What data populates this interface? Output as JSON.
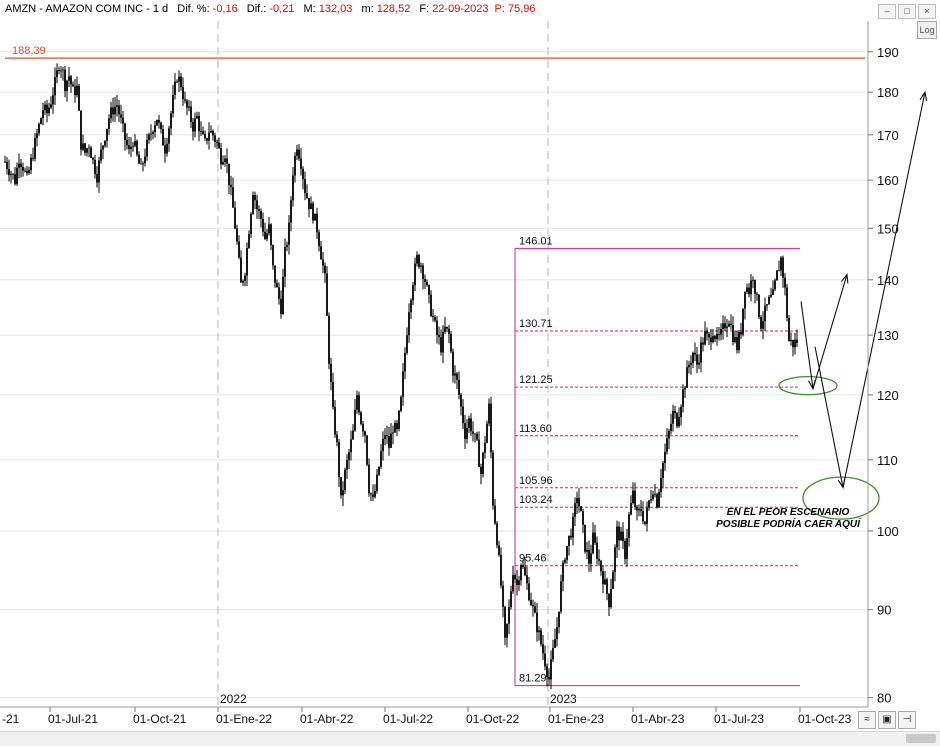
{
  "header": {
    "title": "AMZN - AMAZON COM INC -  1 d",
    "fields": [
      {
        "label": "Dif. %:",
        "value": "-0,16"
      },
      {
        "label": "Dif.:",
        "value": "-0,21"
      },
      {
        "label": "M:",
        "value": "132,03"
      },
      {
        "label": "m:",
        "value": "128,52"
      },
      {
        "label": "F:",
        "value": "22-09-2023"
      }
    ],
    "extra": "P: 75,96",
    "window_buttons": [
      "–",
      "□",
      "×"
    ]
  },
  "controls": {
    "log_label": "Log",
    "toolbar_icons": [
      "wave-icon",
      "save-icon",
      "pin-icon"
    ]
  },
  "colors": {
    "price": "#000000",
    "resistance_line": "#e0502a",
    "fibonacci": "#d0208a",
    "ellipse": "#3f8f2a",
    "arrow": "#111111",
    "header_values": "#d01010"
  },
  "chart_data": {
    "type": "candlestick",
    "symbol": "AMZN",
    "timeframe": "1 d",
    "scale": "log",
    "ylim": [
      79,
      198
    ],
    "y_ticks": [
      80,
      90,
      100,
      110,
      120,
      130,
      140,
      150,
      160,
      170,
      180,
      190
    ],
    "x_ticks": [
      "-21",
      "01-Jul-21",
      "01-Oct-21",
      "01-Ene-22",
      "01-Abr-22",
      "01-Jul-22",
      "01-Oct-22",
      "01-Ene-23",
      "01-Abr-23",
      "01-Jul-23",
      "01-Oct-23"
    ],
    "year_markers": [
      {
        "label": "2022",
        "at": "01-Ene-22"
      },
      {
        "label": "2023",
        "at": "01-Ene-23"
      }
    ],
    "resistance": {
      "value": 188.39,
      "label": "188,39"
    },
    "price_path": [
      [
        0,
        164
      ],
      [
        5,
        162
      ],
      [
        10,
        160
      ],
      [
        14,
        165
      ],
      [
        18,
        163
      ],
      [
        22,
        160
      ],
      [
        26,
        164
      ],
      [
        30,
        168
      ],
      [
        34,
        172
      ],
      [
        38,
        176
      ],
      [
        42,
        175
      ],
      [
        46,
        178
      ],
      [
        50,
        182
      ],
      [
        54,
        187
      ],
      [
        57,
        186
      ],
      [
        60,
        182
      ],
      [
        64,
        184
      ],
      [
        68,
        180
      ],
      [
        72,
        181
      ],
      [
        76,
        168
      ],
      [
        80,
        166
      ],
      [
        84,
        168
      ],
      [
        88,
        164
      ],
      [
        92,
        161
      ],
      [
        96,
        166
      ],
      [
        100,
        170
      ],
      [
        104,
        174
      ],
      [
        108,
        176
      ],
      [
        112,
        177
      ],
      [
        116,
        173
      ],
      [
        120,
        169
      ],
      [
        124,
        166
      ],
      [
        128,
        169
      ],
      [
        132,
        165
      ],
      [
        136,
        162
      ],
      [
        140,
        166
      ],
      [
        144,
        169
      ],
      [
        148,
        172
      ],
      [
        152,
        174
      ],
      [
        156,
        170
      ],
      [
        160,
        167
      ],
      [
        164,
        172
      ],
      [
        168,
        178
      ],
      [
        172,
        184
      ],
      [
        176,
        182
      ],
      [
        180,
        177
      ],
      [
        184,
        175
      ],
      [
        188,
        172
      ],
      [
        192,
        174
      ],
      [
        196,
        170
      ],
      [
        200,
        168
      ],
      [
        204,
        171
      ],
      [
        208,
        170
      ],
      [
        212,
        168
      ],
      [
        216,
        165
      ],
      [
        220,
        166
      ],
      [
        224,
        160
      ],
      [
        228,
        154
      ],
      [
        232,
        147
      ],
      [
        236,
        139
      ],
      [
        240,
        142
      ],
      [
        244,
        150
      ],
      [
        248,
        158
      ],
      [
        252,
        154
      ],
      [
        256,
        152
      ],
      [
        260,
        148
      ],
      [
        264,
        150
      ],
      [
        268,
        142
      ],
      [
        272,
        138
      ],
      [
        276,
        135
      ],
      [
        280,
        145
      ],
      [
        284,
        150
      ],
      [
        288,
        162
      ],
      [
        292,
        168
      ],
      [
        296,
        164
      ],
      [
        300,
        158
      ],
      [
        304,
        155
      ],
      [
        308,
        153
      ],
      [
        312,
        150
      ],
      [
        316,
        145
      ],
      [
        320,
        140
      ],
      [
        324,
        126
      ],
      [
        328,
        117
      ],
      [
        332,
        112
      ],
      [
        336,
        104
      ],
      [
        340,
        108
      ],
      [
        344,
        111
      ],
      [
        348,
        114
      ],
      [
        352,
        120
      ],
      [
        356,
        116
      ],
      [
        360,
        114
      ],
      [
        364,
        106
      ],
      [
        368,
        104
      ],
      [
        372,
        107
      ],
      [
        376,
        111
      ],
      [
        380,
        114
      ],
      [
        384,
        112
      ],
      [
        388,
        115
      ],
      [
        392,
        114
      ],
      [
        396,
        119
      ],
      [
        400,
        127
      ],
      [
        404,
        135
      ],
      [
        408,
        140
      ],
      [
        412,
        144
      ],
      [
        416,
        143
      ],
      [
        420,
        140
      ],
      [
        424,
        136
      ],
      [
        428,
        133
      ],
      [
        432,
        130
      ],
      [
        436,
        128
      ],
      [
        440,
        131
      ],
      [
        444,
        130
      ],
      [
        448,
        124
      ],
      [
        452,
        122
      ],
      [
        456,
        118
      ],
      [
        460,
        114
      ],
      [
        464,
        116
      ],
      [
        468,
        114
      ],
      [
        472,
        112
      ],
      [
        476,
        108
      ],
      [
        480,
        113
      ],
      [
        484,
        118
      ],
      [
        488,
        104
      ],
      [
        492,
        99
      ],
      [
        496,
        93
      ],
      [
        500,
        86
      ],
      [
        504,
        90
      ],
      [
        508,
        95
      ],
      [
        512,
        93
      ],
      [
        516,
        96
      ],
      [
        520,
        94
      ],
      [
        524,
        92
      ],
      [
        528,
        90
      ],
      [
        532,
        88
      ],
      [
        536,
        86
      ],
      [
        540,
        84
      ],
      [
        544,
        82
      ],
      [
        548,
        85
      ],
      [
        552,
        88
      ],
      [
        556,
        93
      ],
      [
        560,
        97
      ],
      [
        564,
        99
      ],
      [
        568,
        101
      ],
      [
        572,
        105
      ],
      [
        576,
        102
      ],
      [
        580,
        98
      ],
      [
        584,
        96
      ],
      [
        588,
        99
      ],
      [
        592,
        97
      ],
      [
        596,
        95
      ],
      [
        600,
        93
      ],
      [
        604,
        91
      ],
      [
        608,
        95
      ],
      [
        612,
        100
      ],
      [
        616,
        99
      ],
      [
        620,
        97
      ],
      [
        624,
        102
      ],
      [
        628,
        105
      ],
      [
        632,
        102
      ],
      [
        636,
        103
      ],
      [
        640,
        101
      ],
      [
        644,
        104
      ],
      [
        648,
        106
      ],
      [
        652,
        104
      ],
      [
        656,
        108
      ],
      [
        660,
        111
      ],
      [
        664,
        114
      ],
      [
        668,
        117
      ],
      [
        672,
        116
      ],
      [
        676,
        119
      ],
      [
        680,
        122
      ],
      [
        684,
        125
      ],
      [
        688,
        127
      ],
      [
        692,
        125
      ],
      [
        696,
        128
      ],
      [
        700,
        130
      ],
      [
        704,
        129
      ],
      [
        708,
        131
      ],
      [
        712,
        129
      ],
      [
        716,
        130
      ],
      [
        720,
        132
      ],
      [
        724,
        133
      ],
      [
        728,
        130
      ],
      [
        732,
        128
      ],
      [
        736,
        131
      ],
      [
        740,
        139
      ],
      [
        744,
        138
      ],
      [
        748,
        141
      ],
      [
        752,
        136
      ],
      [
        756,
        132
      ],
      [
        760,
        134
      ],
      [
        764,
        136
      ],
      [
        768,
        137
      ],
      [
        772,
        141
      ],
      [
        776,
        144
      ],
      [
        780,
        138
      ],
      [
        784,
        129
      ],
      [
        788,
        128.5
      ],
      [
        792,
        129
      ]
    ],
    "fibonacci": {
      "levels": [
        {
          "value": 146.01,
          "label": "146.01"
        },
        {
          "value": 130.71,
          "label": "130.71"
        },
        {
          "value": 121.25,
          "label": "121.25"
        },
        {
          "value": 113.6,
          "label": "113.60"
        },
        {
          "value": 105.96,
          "label": "105.96"
        },
        {
          "value": 103.24,
          "label": "103.24"
        },
        {
          "value": 95.46,
          "label": "95.46"
        },
        {
          "value": 81.29,
          "label": "81.29"
        }
      ]
    },
    "annotation": [
      "EN EL PEOR ESCENARIO",
      "POSIBLE PODRÍA CAER AQUÍ"
    ],
    "projection_paths": [
      [
        [
          796,
          136
        ],
        [
          808,
          121
        ],
        [
          842,
          141
        ]
      ],
      [
        [
          810,
          128
        ],
        [
          838,
          106
        ],
        [
          920,
          180
        ]
      ]
    ],
    "ellipses": [
      {
        "center_value": 121.5
      },
      {
        "center_value": 104.5
      }
    ]
  }
}
